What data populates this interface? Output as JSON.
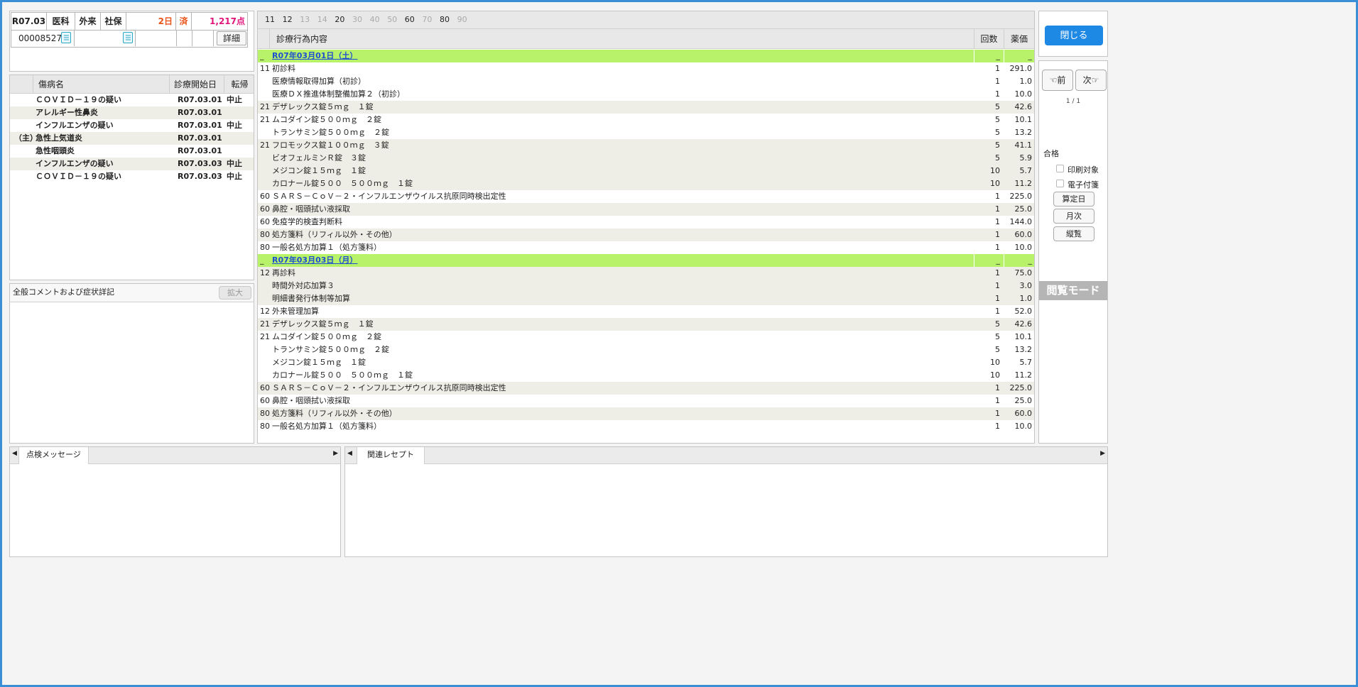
{
  "patient": {
    "date": "R07.03",
    "dept": "医科",
    "type": "外来",
    "insurance": "社保",
    "days": "2日",
    "status": "済",
    "points": "1,217点",
    "id": "00008527",
    "detail_button": "詳細",
    "days_color": "#e8541a",
    "points_color": "#e0157a"
  },
  "disease_table": {
    "headers": {
      "name": "傷病名",
      "start": "診療開始日",
      "outcome": "転帰"
    },
    "rows": [
      {
        "prefix": "",
        "name": "ＣＯＶＩＤ－１９の疑い",
        "start": "R07.03.01",
        "outcome": "中止"
      },
      {
        "prefix": "",
        "name": "アレルギー性鼻炎",
        "start": "R07.03.01",
        "outcome": ""
      },
      {
        "prefix": "",
        "name": "インフルエンザの疑い",
        "start": "R07.03.01",
        "outcome": "中止"
      },
      {
        "prefix": "（主）",
        "name": "急性上気道炎",
        "start": "R07.03.01",
        "outcome": ""
      },
      {
        "prefix": "",
        "name": "急性咽頭炎",
        "start": "R07.03.01",
        "outcome": ""
      },
      {
        "prefix": "",
        "name": "インフルエンザの疑い",
        "start": "R07.03.03",
        "outcome": "中止"
      },
      {
        "prefix": "",
        "name": "ＣＯＶＩＤ－１９の疑い",
        "start": "R07.03.03",
        "outcome": "中止"
      }
    ]
  },
  "comments": {
    "title": "全般コメントおよび症状詳記",
    "expand_button": "拡大"
  },
  "category_tabs": [
    {
      "label": "11",
      "active": true
    },
    {
      "label": "12",
      "active": true
    },
    {
      "label": "13",
      "active": false
    },
    {
      "label": "14",
      "active": false
    },
    {
      "label": "20",
      "active": true
    },
    {
      "label": "30",
      "active": false
    },
    {
      "label": "40",
      "active": false
    },
    {
      "label": "50",
      "active": false
    },
    {
      "label": "60",
      "active": true
    },
    {
      "label": "70",
      "active": false
    },
    {
      "label": "80",
      "active": true
    },
    {
      "label": "90",
      "active": false
    }
  ],
  "treatment_table": {
    "headers": {
      "content": "診療行為内容",
      "count": "回数",
      "price": "薬価"
    },
    "rows": [
      {
        "kind": "date",
        "label": "R07年03月01日（土）",
        "left_mark": "_",
        "count_mark": "_",
        "price_mark": "_"
      },
      {
        "kind": "item",
        "code": "11",
        "name": "初診料",
        "count": "1",
        "price": "291.0",
        "shade": false
      },
      {
        "kind": "item",
        "code": "",
        "name": "医療情報取得加算（初診）",
        "count": "1",
        "price": "1.0",
        "shade": false
      },
      {
        "kind": "item",
        "code": "",
        "name": "医療ＤＸ推進体制整備加算２（初診）",
        "count": "1",
        "price": "10.0",
        "shade": false
      },
      {
        "kind": "item",
        "code": "21",
        "name": "デザレックス錠５ｍｇ　１錠",
        "count": "5",
        "price": "42.6",
        "shade": true
      },
      {
        "kind": "item",
        "code": "21",
        "name": "ムコダイン錠５００ｍｇ　２錠",
        "count": "5",
        "price": "10.1",
        "shade": false
      },
      {
        "kind": "item",
        "code": "",
        "name": "トランサミン錠５００ｍｇ　２錠",
        "count": "5",
        "price": "13.2",
        "shade": false
      },
      {
        "kind": "item",
        "code": "21",
        "name": "フロモックス錠１００ｍｇ　３錠",
        "count": "5",
        "price": "41.1",
        "shade": true
      },
      {
        "kind": "item",
        "code": "",
        "name": "ビオフェルミンＲ錠　３錠",
        "count": "5",
        "price": "5.9",
        "shade": true
      },
      {
        "kind": "item",
        "code": "",
        "name": "メジコン錠１５ｍｇ　１錠",
        "count": "10",
        "price": "5.7",
        "shade": true
      },
      {
        "kind": "item",
        "code": "",
        "name": "カロナール錠５００　５００ｍｇ　１錠",
        "count": "10",
        "price": "11.2",
        "shade": true
      },
      {
        "kind": "item",
        "code": "60",
        "name": "ＳＡＲＳ－ＣｏＶ－２・インフルエンザウイルス抗原同時検出定性",
        "count": "1",
        "price": "225.0",
        "shade": false
      },
      {
        "kind": "item",
        "code": "60",
        "name": "鼻腔・咽頭拭い液採取",
        "count": "1",
        "price": "25.0",
        "shade": true
      },
      {
        "kind": "item",
        "code": "60",
        "name": "免疫学的検査判断料",
        "count": "1",
        "price": "144.0",
        "shade": false
      },
      {
        "kind": "item",
        "code": "80",
        "name": "処方箋料（リフィル以外・その他）",
        "count": "1",
        "price": "60.0",
        "shade": true
      },
      {
        "kind": "item",
        "code": "80",
        "name": "一般名処方加算１（処方箋料）",
        "count": "1",
        "price": "10.0",
        "shade": false
      },
      {
        "kind": "date",
        "label": "R07年03月03日（月）",
        "left_mark": "_",
        "count_mark": "_",
        "price_mark": "_"
      },
      {
        "kind": "item",
        "code": "12",
        "name": "再診料",
        "count": "1",
        "price": "75.0",
        "shade": true
      },
      {
        "kind": "item",
        "code": "",
        "name": "時間外対応加算３",
        "count": "1",
        "price": "3.0",
        "shade": true
      },
      {
        "kind": "item",
        "code": "",
        "name": "明細書発行体制等加算",
        "count": "1",
        "price": "1.0",
        "shade": true
      },
      {
        "kind": "item",
        "code": "12",
        "name": "外来管理加算",
        "count": "1",
        "price": "52.0",
        "shade": false
      },
      {
        "kind": "item",
        "code": "21",
        "name": "デザレックス錠５ｍｇ　１錠",
        "count": "5",
        "price": "42.6",
        "shade": true
      },
      {
        "kind": "item",
        "code": "21",
        "name": "ムコダイン錠５００ｍｇ　２錠",
        "count": "5",
        "price": "10.1",
        "shade": false
      },
      {
        "kind": "item",
        "code": "",
        "name": "トランサミン錠５００ｍｇ　２錠",
        "count": "5",
        "price": "13.2",
        "shade": false
      },
      {
        "kind": "item",
        "code": "",
        "name": "メジコン錠１５ｍｇ　１錠",
        "count": "10",
        "price": "5.7",
        "shade": false
      },
      {
        "kind": "item",
        "code": "",
        "name": "カロナール錠５００　５００ｍｇ　１錠",
        "count": "10",
        "price": "11.2",
        "shade": false
      },
      {
        "kind": "item",
        "code": "60",
        "name": "ＳＡＲＳ－ＣｏＶ－２・インフルエンザウイルス抗原同時検出定性",
        "count": "1",
        "price": "225.0",
        "shade": true
      },
      {
        "kind": "item",
        "code": "60",
        "name": "鼻腔・咽頭拭い液採取",
        "count": "1",
        "price": "25.0",
        "shade": false
      },
      {
        "kind": "item",
        "code": "80",
        "name": "処方箋料（リフィル以外・その他）",
        "count": "1",
        "price": "60.0",
        "shade": true
      },
      {
        "kind": "item",
        "code": "80",
        "name": "一般名処方加算１（処方箋料）",
        "count": "1",
        "price": "10.0",
        "shade": false
      }
    ]
  },
  "right_panel": {
    "close_button": "閉じる",
    "prev_button": "前",
    "next_button": "次",
    "prev_icon": "hand-pointing-left-icon",
    "next_icon": "hand-pointing-right-icon",
    "page": "1 / 1",
    "result": "合格",
    "print_target": "印刷対象",
    "e_attach": "電子付箋",
    "calc_day_button": "算定日",
    "monthly_button": "月次",
    "vertical_button": "縦覧",
    "mode_label": "閲覧モード",
    "accent_color": "#1e88e5",
    "mode_bg": "#b5b5b5"
  },
  "bottom": {
    "check_tab": "点検メッセージ",
    "related_tab": "関連レセプト"
  },
  "date_row_color": "#b8f26a",
  "shade_color": "#efeee6"
}
